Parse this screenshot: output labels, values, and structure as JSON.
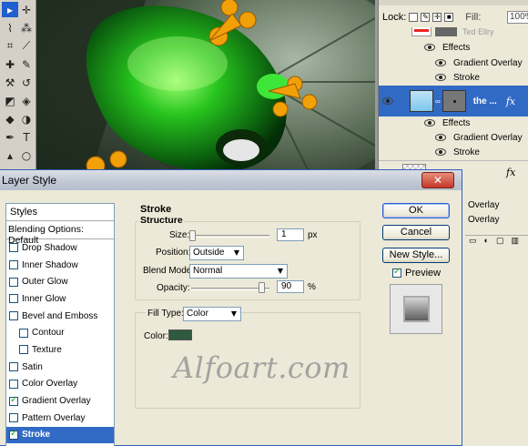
{
  "toolbox": {
    "tools": [
      {
        "name": "move-tool-icon",
        "glyph": "▸"
      },
      {
        "name": "marquee-tool-icon",
        "glyph": "✛"
      },
      {
        "name": "lasso-tool-icon",
        "glyph": "⌇"
      },
      {
        "name": "magic-wand-tool-icon",
        "glyph": "⁂"
      },
      {
        "name": "crop-tool-icon",
        "glyph": "⌗"
      },
      {
        "name": "slice-tool-icon",
        "glyph": "⟋"
      },
      {
        "name": "healing-brush-tool-icon",
        "glyph": "✚"
      },
      {
        "name": "brush-tool-icon",
        "glyph": "✎"
      },
      {
        "name": "clone-stamp-tool-icon",
        "glyph": "⚒"
      },
      {
        "name": "history-brush-tool-icon",
        "glyph": "↺"
      },
      {
        "name": "eraser-tool-icon",
        "glyph": "◩"
      },
      {
        "name": "paint-bucket-tool-icon",
        "glyph": "◈"
      },
      {
        "name": "blur-tool-icon",
        "glyph": "◆"
      },
      {
        "name": "dodge-tool-icon",
        "glyph": "◑"
      },
      {
        "name": "pen-tool-icon",
        "glyph": "✒"
      },
      {
        "name": "type-tool-icon",
        "glyph": "T"
      },
      {
        "name": "path-selection-tool-icon",
        "glyph": "▴"
      },
      {
        "name": "ellipse-tool-icon",
        "glyph": "○"
      }
    ]
  },
  "layers_panel": {
    "lock_label": "Lock:",
    "fill_label": "Fill:",
    "fill_value": "100%",
    "layer_partial_name": "Ted Ellry",
    "effects_label": "Effects",
    "effects_1": [
      "Gradient Overlay",
      "Stroke"
    ],
    "selected_layer_name": "the ...",
    "effects_2": [
      "Gradient Overlay",
      "Stroke"
    ],
    "fx_symbol": "fx",
    "partial_effects_3": [
      "Overlay",
      "Overlay"
    ]
  },
  "dialog": {
    "title": "Layer Style",
    "close_glyph": "✕",
    "styles_header": "Styles",
    "blending_options": "Blending Options: Default",
    "style_items": [
      {
        "label": "Drop Shadow",
        "checked": false,
        "indent": false,
        "selected": false
      },
      {
        "label": "Inner Shadow",
        "checked": false,
        "indent": false,
        "selected": false
      },
      {
        "label": "Outer Glow",
        "checked": false,
        "indent": false,
        "selected": false
      },
      {
        "label": "Inner Glow",
        "checked": false,
        "indent": false,
        "selected": false
      },
      {
        "label": "Bevel and Emboss",
        "checked": false,
        "indent": false,
        "selected": false
      },
      {
        "label": "Contour",
        "checked": false,
        "indent": true,
        "selected": false
      },
      {
        "label": "Texture",
        "checked": false,
        "indent": true,
        "selected": false
      },
      {
        "label": "Satin",
        "checked": false,
        "indent": false,
        "selected": false
      },
      {
        "label": "Color Overlay",
        "checked": false,
        "indent": false,
        "selected": false
      },
      {
        "label": "Gradient Overlay",
        "checked": true,
        "indent": false,
        "selected": false
      },
      {
        "label": "Pattern Overlay",
        "checked": false,
        "indent": false,
        "selected": false
      },
      {
        "label": "Stroke",
        "checked": true,
        "indent": false,
        "selected": true
      }
    ],
    "stroke": {
      "section_title": "Stroke",
      "structure_title": "Structure",
      "size_label": "Size:",
      "size_value": "1",
      "size_unit": "px",
      "size_fraction": 0.0,
      "position_label": "Position:",
      "position_value": "Outside",
      "blend_mode_label": "Blend Mode:",
      "blend_mode_value": "Normal",
      "opacity_label": "Opacity:",
      "opacity_value": "90",
      "opacity_unit": "%",
      "opacity_fraction": 0.9,
      "fill_type_label": "Fill Type:",
      "fill_type_value": "Color",
      "color_label": "Color:",
      "color_hex": "#2f5a3e"
    },
    "watermark": "Alfoart.com",
    "buttons": {
      "ok": "OK",
      "cancel": "Cancel",
      "new_style": "New Style...",
      "preview_label": "Preview",
      "preview_checked": true
    }
  }
}
